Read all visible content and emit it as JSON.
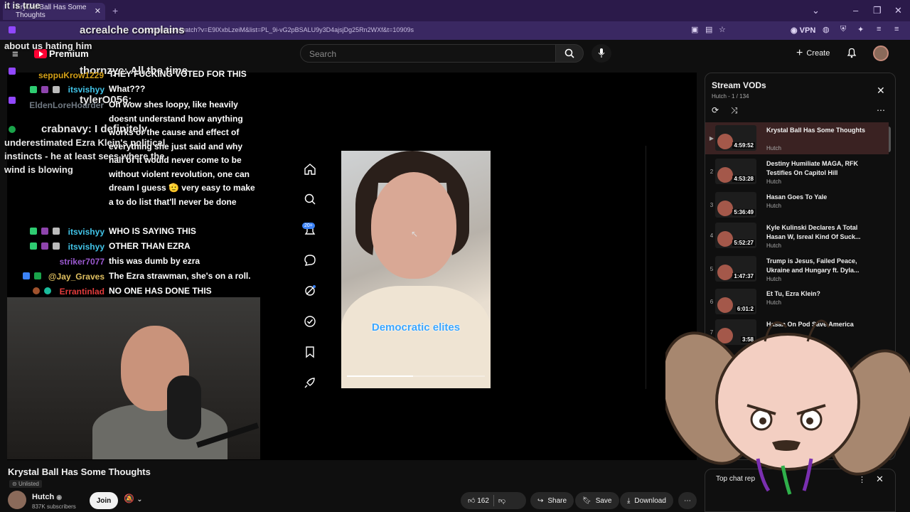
{
  "browser": {
    "tab_title": "Krystal Ball Has Some Thoughts",
    "url": "youtube.com/watch?v=E9lXxbLzeiM&list=PL_9i-vG2pBSALU9y3D4ajsjDg25Rn2WXf&t=10909s",
    "vpn_label": "VPN",
    "new_tab": "+",
    "tab_close": "✕"
  },
  "youtube_header": {
    "brand": "Premium",
    "search_placeholder": "Search",
    "create_label": "Create"
  },
  "chat_overlay": {
    "big_lines": [
      "it is true",
      "acrealche complains",
      "about us hating him",
      "thornzyc: All the time",
      "tylerO056:",
      "crabnavy: I definitely",
      "underestimated Ezra Klein's political",
      "instincts - he at least sees where the",
      "wind is blowing"
    ],
    "lines": [
      {
        "user": "seppuKrow1229",
        "user_color": "#d4a017",
        "message": "THEY FUCKING VOTED FOR THIS"
      },
      {
        "user": "itsvishyy",
        "user_color": "#41c4e8",
        "message": "What???"
      },
      {
        "user": "EldenLoreHoarder",
        "user_color": "#b9c8d8",
        "message": "Oh wow shes loopy, like heavily doesnt understand how anything works or the cause and effect of everything she just said and why half of it would never come to be without violent revolution, one can dream I guess 🫡 very easy to make a to do list that'll never be done"
      },
      {
        "user": "itsvishyy",
        "user_color": "#41c4e8",
        "message": "WHO IS SAYING THIS"
      },
      {
        "user": "itsvishyy",
        "user_color": "#41c4e8",
        "message": "OTHER THAN EZRA"
      },
      {
        "user": "striker7077",
        "user_color": "#9b59d0",
        "message": "this was dumb by ezra"
      },
      {
        "user": "@Jay_Graves",
        "user_color": "#e0c060",
        "message": "The Ezra strawman, she's on a roll."
      },
      {
        "user": "Errantinlad",
        "user_color": "#e23c3c",
        "message": "NO ONE HAS DONE THIS"
      }
    ]
  },
  "video": {
    "caption": "Democratic elites",
    "progress": 0.48,
    "notification_badge": "20+"
  },
  "below_video": {
    "title": "Krystal Ball Has Some Thoughts",
    "visibility": "Unlisted",
    "channel": "Hutch",
    "subscribers": "837K subscribers",
    "join_label": "Join",
    "likes": "162",
    "share_label": "Share",
    "save_label": "Save",
    "download_label": "Download"
  },
  "playlist": {
    "title": "Stream VODs",
    "subtitle": "Hutch - 1 / 134",
    "items": [
      {
        "num": "▶",
        "title": "Krystal Ball Has Some Thoughts",
        "duration": "4:59:52",
        "channel": "Hutch"
      },
      {
        "num": "2",
        "title": "Destiny Humiliate MAGA, RFK Testifies On Capitol Hill",
        "duration": "4:53:28",
        "channel": "Hutch"
      },
      {
        "num": "3",
        "title": "Hasan Goes To Yale",
        "duration": "5:36:49",
        "channel": "Hutch"
      },
      {
        "num": "4",
        "title": "Kyle Kulinski Declares A Total Hasan W, Isreal Kind Of Suck...",
        "duration": "5:52:27",
        "channel": "Hutch"
      },
      {
        "num": "5",
        "title": "Trump is Jesus, Failed Peace, Ukraine and Hungary ft. Dyla...",
        "duration": "1:47:37",
        "channel": "Hutch"
      },
      {
        "num": "6",
        "title": "Et Tu, Ezra Klein?",
        "duration": "6:01:2",
        "channel": "Hutch"
      },
      {
        "num": "7",
        "title": "Hasan On Pod Save America",
        "duration": "3:58",
        "channel": ""
      }
    ]
  },
  "top_chat": {
    "label": "Top chat rep"
  },
  "colors": {
    "accent_red": "#ff0033",
    "browser_purple": "#2b1a4a",
    "caption_blue": "#3aa6ff"
  }
}
